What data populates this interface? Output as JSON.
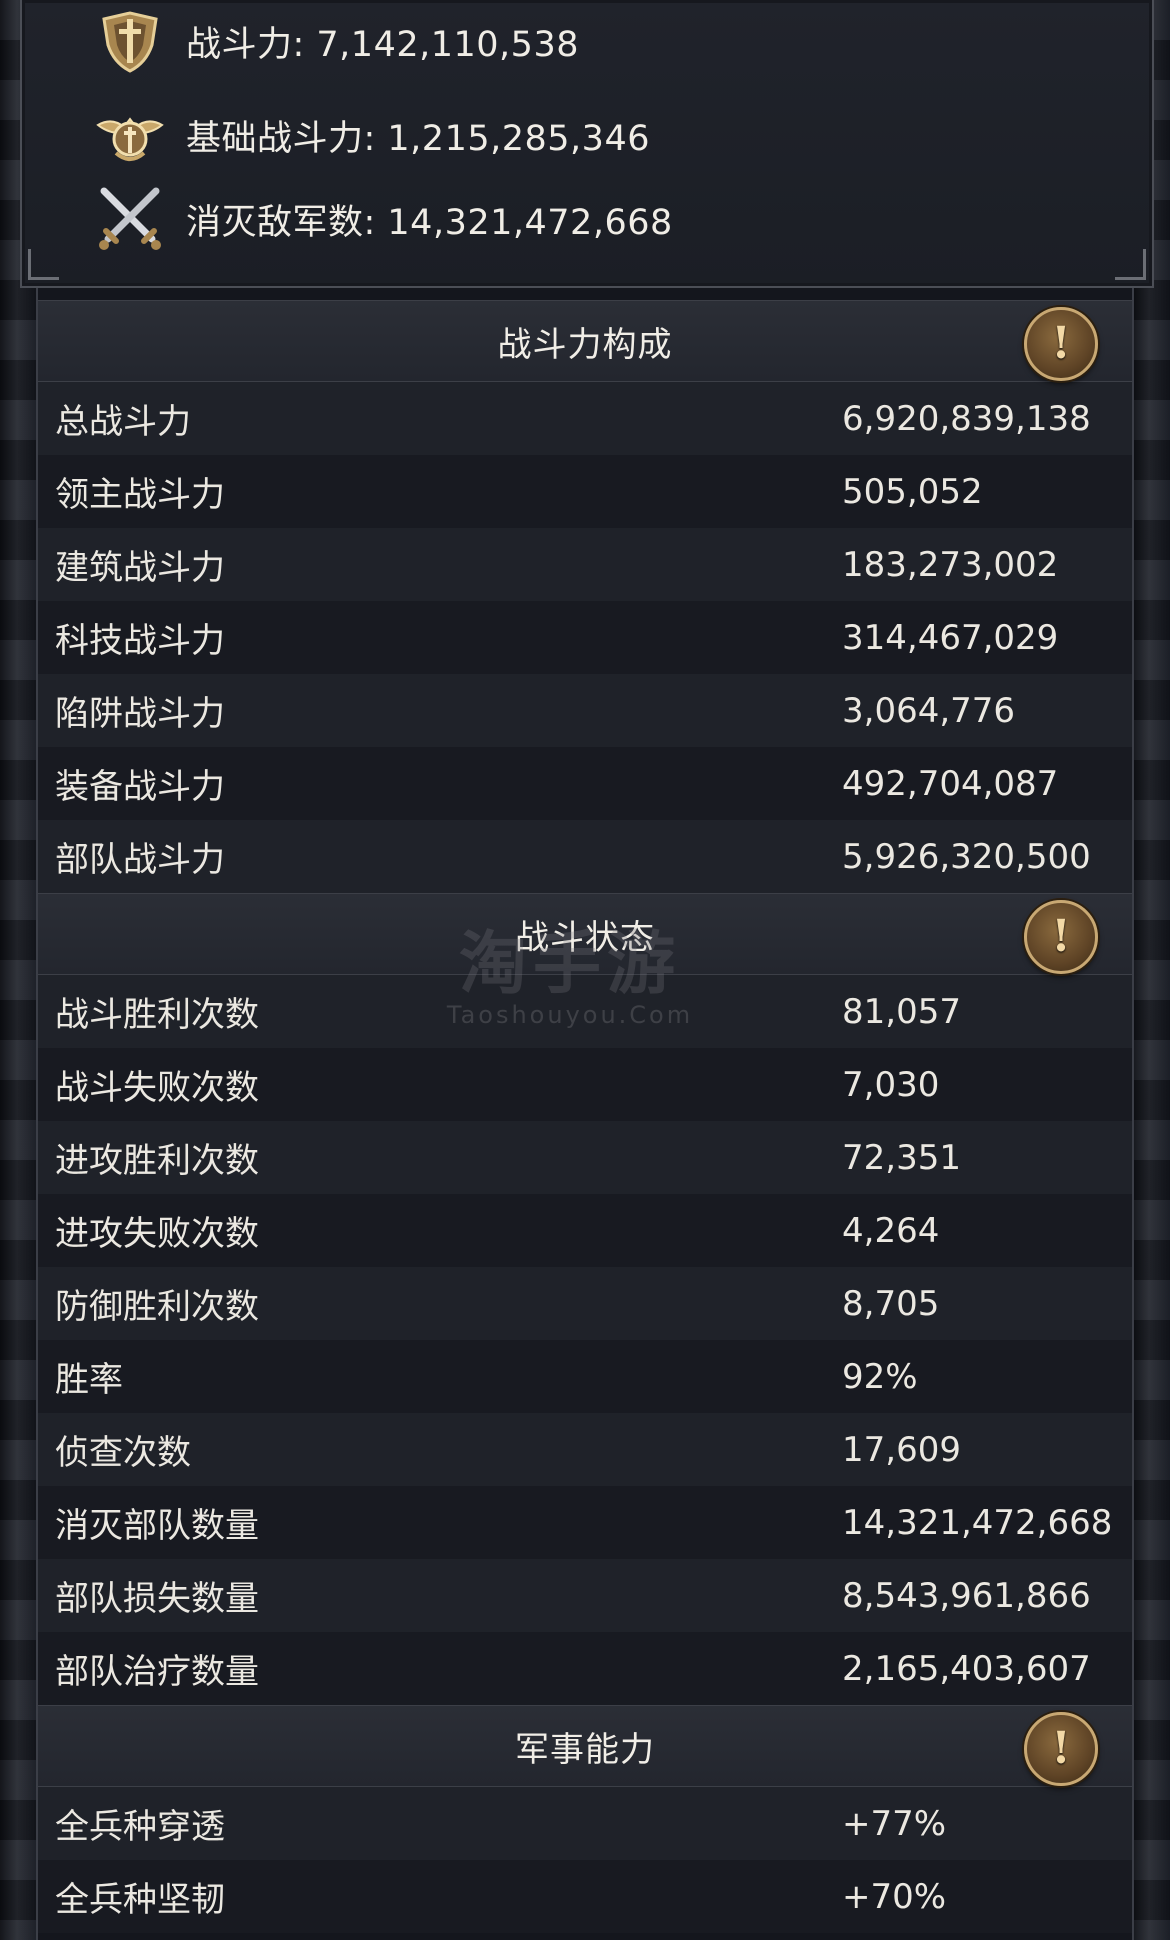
{
  "top_stats": [
    {
      "label": "战斗力: 7,142,110,538",
      "icon": "shield-sword-emblem-icon"
    },
    {
      "label": "基础战斗力: 1,215,285,346",
      "icon": "winged-emblem-icon"
    },
    {
      "label": "消灭敌军数: 14,321,472,668",
      "icon": "crossed-swords-icon"
    }
  ],
  "sections": [
    {
      "title": "战斗力构成",
      "rows": [
        {
          "label": "总战斗力",
          "value": "6,920,839,138"
        },
        {
          "label": "领主战斗力",
          "value": "505,052"
        },
        {
          "label": "建筑战斗力",
          "value": "183,273,002"
        },
        {
          "label": "科技战斗力",
          "value": "314,467,029"
        },
        {
          "label": "陷阱战斗力",
          "value": "3,064,776"
        },
        {
          "label": "装备战斗力",
          "value": "492,704,087"
        },
        {
          "label": "部队战斗力",
          "value": "5,926,320,500"
        }
      ]
    },
    {
      "title": "战斗状态",
      "rows": [
        {
          "label": "战斗胜利次数",
          "value": "81,057"
        },
        {
          "label": "战斗失败次数",
          "value": "7,030"
        },
        {
          "label": "进攻胜利次数",
          "value": "72,351"
        },
        {
          "label": "进攻失败次数",
          "value": "4,264"
        },
        {
          "label": "防御胜利次数",
          "value": "8,705"
        },
        {
          "label": "胜率",
          "value": "92%"
        },
        {
          "label": "侦查次数",
          "value": "17,609"
        },
        {
          "label": "消灭部队数量",
          "value": "14,321,472,668"
        },
        {
          "label": "部队损失数量",
          "value": "8,543,961,866"
        },
        {
          "label": "部队治疗数量",
          "value": "2,165,403,607"
        }
      ]
    },
    {
      "title": "军事能力",
      "rows": [
        {
          "label": "全兵种穿透",
          "value": "+77%"
        },
        {
          "label": "全兵种坚韧",
          "value": "+70%"
        }
      ]
    }
  ],
  "info_button_symbol": "!",
  "watermark": {
    "main": "淘手游",
    "sub": "Taoshouyou.Com"
  },
  "colors": {
    "gold": "#c8a873",
    "row_dark": "#181a21",
    "row_light": "#1f2229"
  }
}
